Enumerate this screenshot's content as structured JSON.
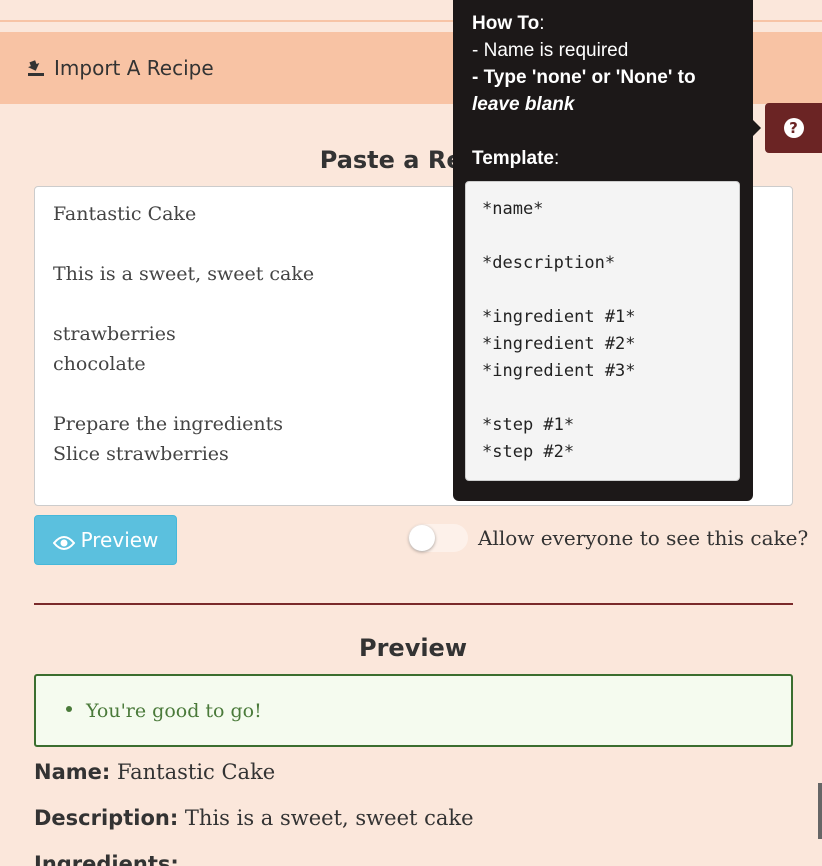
{
  "import_header": {
    "title": "Import A Recipe",
    "icon": "import-icon"
  },
  "paste": {
    "title": "Paste a Recip",
    "lines": [
      "Fantastic Cake",
      "",
      "This is a sweet, sweet cake",
      "",
      "strawberries",
      "chocolate",
      "",
      "Prepare the ingredients",
      "Slice strawberries"
    ]
  },
  "controls": {
    "preview_button": "Preview",
    "toggle_label": "Allow everyone to see this cake?",
    "toggle_on": false
  },
  "preview": {
    "title": "Preview",
    "status_message": "You're good to go!",
    "name_label": "Name:",
    "name_value": "Fantastic Cake",
    "description_label": "Description:",
    "description_value": "This is a sweet, sweet cake",
    "ingredients_label": "Ingredients:"
  },
  "help": {
    "icon": "question-icon",
    "howto_heading": "How To",
    "howto_colon": ":",
    "line1": "- Name is required",
    "line2": "- Type 'none' or 'None' to",
    "line3": "leave blank",
    "template_heading": "Template",
    "template_colon": ":",
    "template_lines": [
      "*name*",
      "",
      "*description*",
      "",
      "*ingredient #1*",
      "*ingredient #2*",
      "*ingredient #3*",
      "",
      "*step #1*",
      "*step #2*"
    ]
  },
  "colors": {
    "page_bg": "#fbe7db",
    "header_bg": "#f8c3a4",
    "primary_button": "#5bc0de",
    "help_tab": "#6b2424",
    "tooltip_bg": "#1c1818",
    "success_border": "#3b6e2f"
  }
}
